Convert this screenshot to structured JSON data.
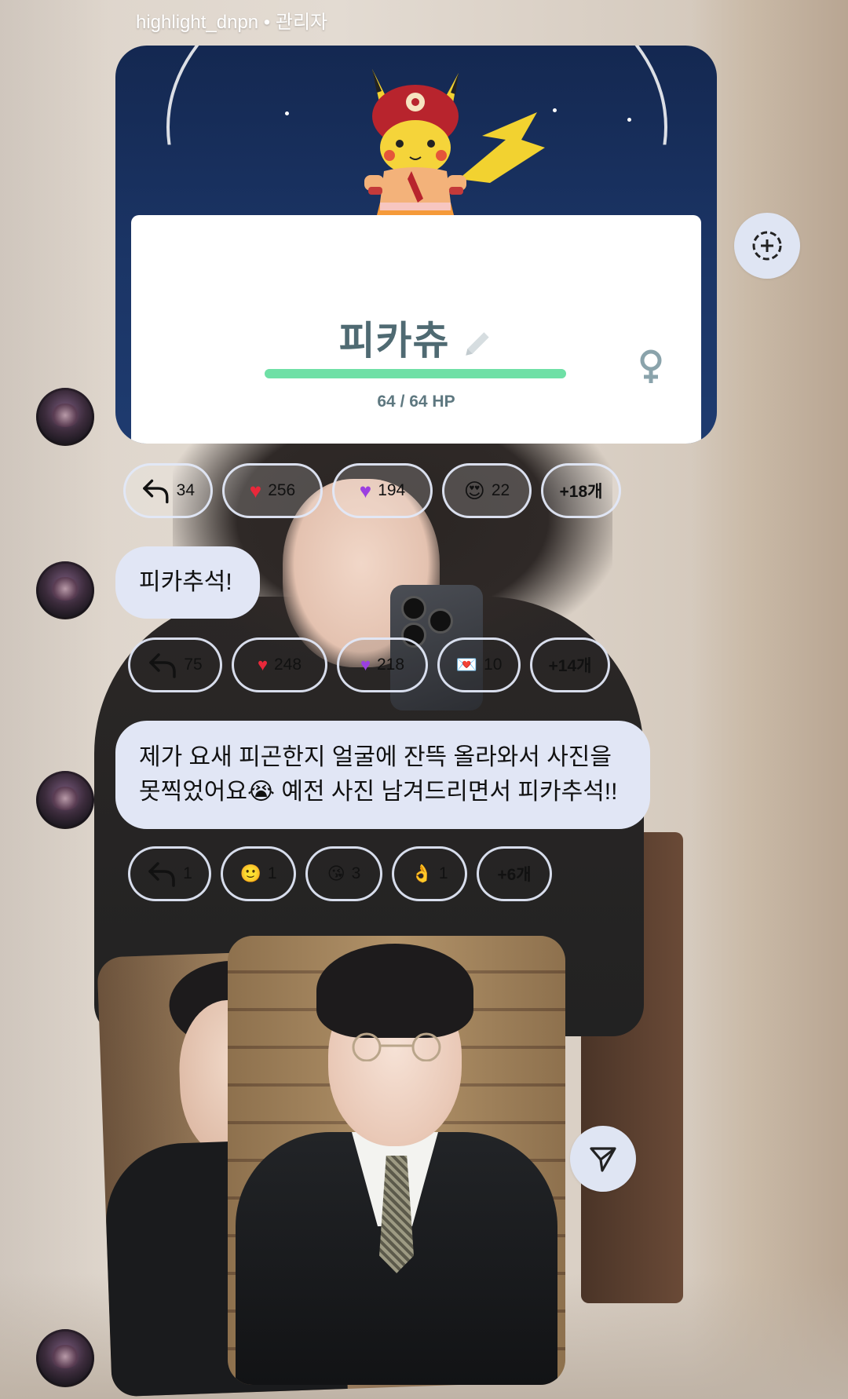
{
  "header": {
    "label": "highlight_dnpn • 관리자"
  },
  "pokemon_card": {
    "name": "피카츄",
    "hp_text": "64 / 64 HP",
    "hp_current": 64,
    "hp_max": 64,
    "colors": {
      "hp_bar": "#6fe0a6",
      "sky": "#1b3566"
    }
  },
  "reactions_1": {
    "reply": "34",
    "heart_red": "256",
    "heart_purple": "194",
    "heart_eyes": "22",
    "more": "+18개"
  },
  "message_1": {
    "text": "피카추석!"
  },
  "reactions_2": {
    "reply": "75",
    "heart_red": "248",
    "heart_purple": "218",
    "heart_letter": "10",
    "more": "+14개"
  },
  "message_2": {
    "line1": "제가 요새 피곤한지 얼굴에 잔뜩 올라와서 사진을",
    "line2": "못찍었어요😭 예전 사진 남겨드리면서 피카추석!!"
  },
  "reactions_3": {
    "reply": "1",
    "slight_smile": "1",
    "kiss": "3",
    "ok_hand": "1",
    "more": "+6개"
  },
  "icons": {
    "add_reaction": "add-reaction-icon",
    "send": "send-icon",
    "reply": "reply-arrow-icon"
  }
}
